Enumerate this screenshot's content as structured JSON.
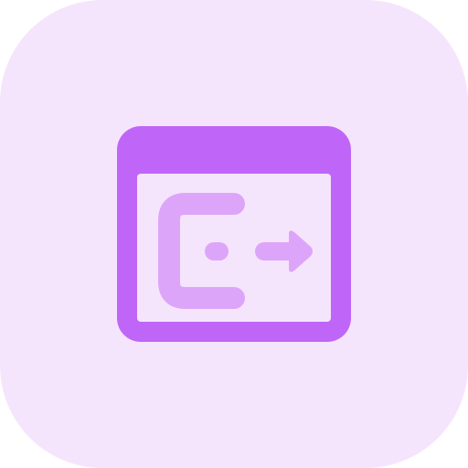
{
  "icon": {
    "name": "browser-logout-icon",
    "colors": {
      "tile_background": "#F5E5FC",
      "window_primary": "#BF66F8",
      "content_background": "#F5E5FC",
      "glyph_secondary": "#DDA5F9",
      "arrow_accent": "#BF66F8"
    }
  }
}
